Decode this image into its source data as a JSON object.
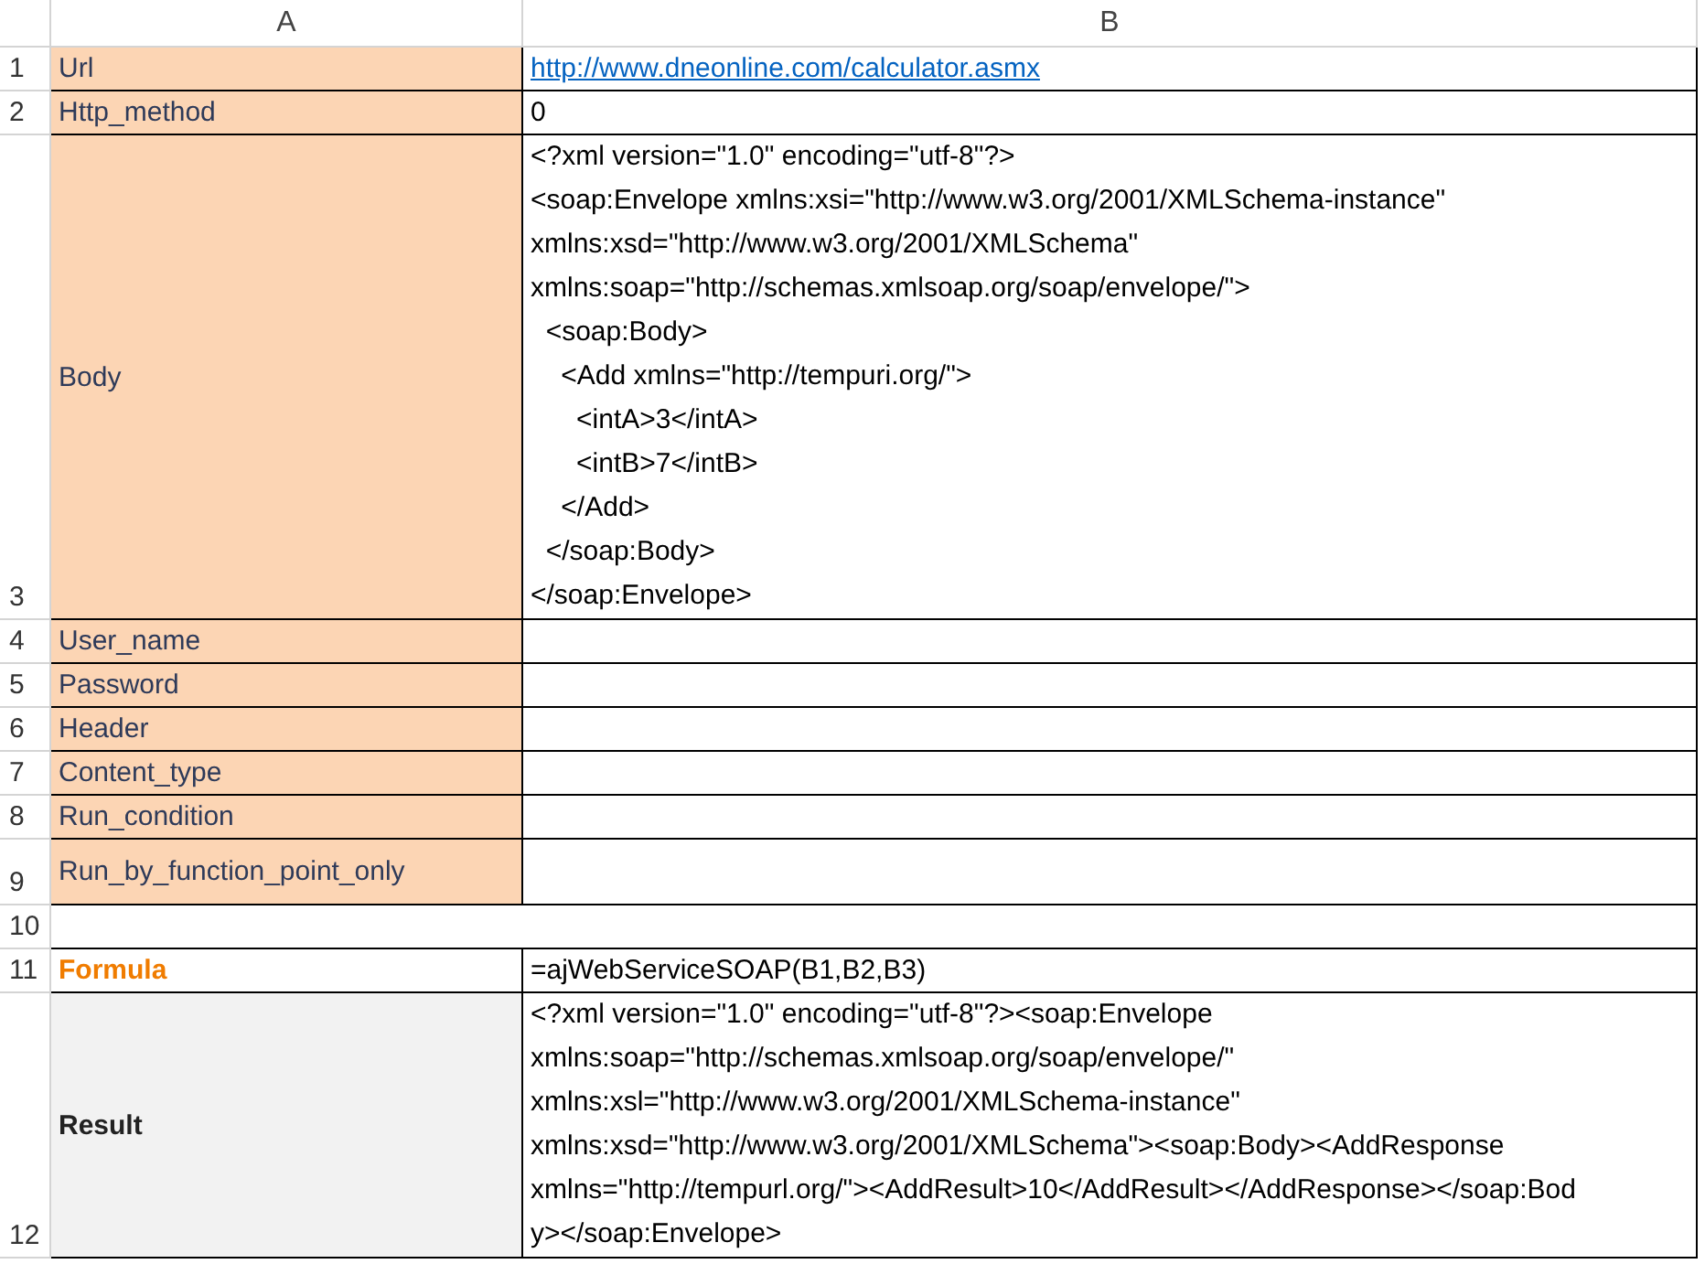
{
  "columns": [
    "A",
    "B"
  ],
  "rows": [
    {
      "number": "1",
      "kind": "param",
      "label": "Url",
      "value": {
        "kind": "link",
        "text": "http://www.dneonline.com/calculator.asmx"
      }
    },
    {
      "number": "2",
      "kind": "param",
      "label": "Http_method",
      "value": {
        "kind": "text",
        "text": "0"
      }
    },
    {
      "number": "3",
      "kind": "param",
      "label": "Body",
      "value": {
        "kind": "lines",
        "lines": [
          "<?xml version=\"1.0\" encoding=\"utf-8\"?>",
          "<soap:Envelope xmlns:xsi=\"http://www.w3.org/2001/XMLSchema-instance\"",
          "xmlns:xsd=\"http://www.w3.org/2001/XMLSchema\"",
          "xmlns:soap=\"http://schemas.xmlsoap.org/soap/envelope/\">",
          "  <soap:Body>",
          "    <Add xmlns=\"http://tempuri.org/\">",
          "      <intA>3</intA>",
          "      <intB>7</intB>",
          "    </Add>",
          "  </soap:Body>",
          "</soap:Envelope>"
        ]
      }
    },
    {
      "number": "4",
      "kind": "param",
      "label": "User_name"
    },
    {
      "number": "5",
      "kind": "param",
      "label": "Password"
    },
    {
      "number": "6",
      "kind": "param",
      "label": "Header"
    },
    {
      "number": "7",
      "kind": "param",
      "label": "Content_type"
    },
    {
      "number": "8",
      "kind": "param",
      "label": "Run_condition"
    },
    {
      "number": "9",
      "kind": "param",
      "label": "Run_by_function_point_only"
    },
    {
      "number": "10",
      "kind": "blank"
    },
    {
      "number": "11",
      "kind": "formula",
      "label": "Formula",
      "value": {
        "kind": "text",
        "text": "=ajWebServiceSOAP(B1,B2,B3)"
      }
    },
    {
      "number": "12",
      "kind": "result",
      "label": "Result",
      "value": {
        "kind": "lines",
        "lines": [
          "<?xml version=\"1.0\" encoding=\"utf-8\"?><soap:Envelope",
          "xmlns:soap=\"http://schemas.xmlsoap.org/soap/envelope/\"",
          "xmlns:xsl=\"http://www.w3.org/2001/XMLSchema-instance\"",
          "xmlns:xsd=\"http://www.w3.org/2001/XMLSchema\"><soap:Body><AddResponse",
          "xmlns=\"http://tempurl.org/\"><AddResult>10</AddResult></AddResponse></soap:Bod",
          "y></soap:Envelope>"
        ]
      }
    }
  ]
}
